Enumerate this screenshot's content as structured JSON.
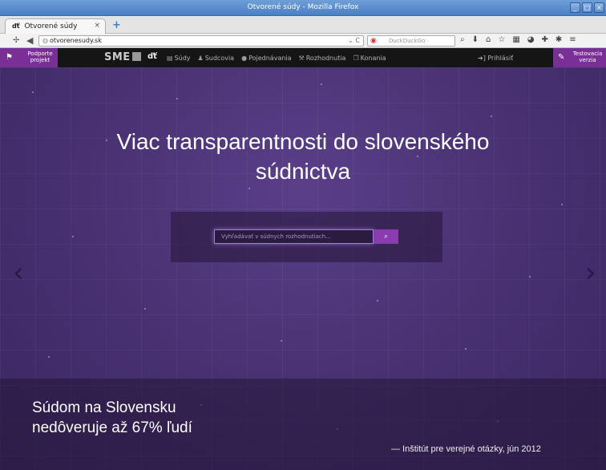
{
  "window": {
    "title": "Otvorené súdy - Mozilla Firefox",
    "buttons": [
      "_",
      "□",
      "×"
    ]
  },
  "tab": {
    "icon": "scales-icon",
    "icon_glyph": "ďť",
    "label": "Otvorené súdy",
    "close": "×"
  },
  "new_tab": "+",
  "address": {
    "url": "otvorenesudy.sk",
    "reload": "⌄ C"
  },
  "search": {
    "placeholder": "DuckDuckGo",
    "engine_glyph": "◉"
  },
  "site_nav": {
    "support_label": "Podporte projekt",
    "logo": "SME",
    "scale_glyph": "ďť",
    "menu": [
      {
        "icon": "document-icon",
        "glyph": "▤",
        "label": "Súdy"
      },
      {
        "icon": "person-icon",
        "glyph": "♟",
        "label": "Sudcovia"
      },
      {
        "icon": "chat-icon",
        "glyph": "●",
        "label": "Pojednávania"
      },
      {
        "icon": "gavel-icon",
        "glyph": "⚒",
        "label": "Rozhodnutia"
      },
      {
        "icon": "copy-icon",
        "glyph": "❐",
        "label": "Konania"
      }
    ],
    "login": "➜] Prihlásiť",
    "beta_label": "Testovacia verzia"
  },
  "hero": {
    "headline": "Viac transparentnosti do slovenského súdnictva",
    "search_placeholder": "Vyhľadávať v súdnych rozhodnutiach...",
    "search_button": "⌕"
  },
  "quote": {
    "text": "Súdom na Slovensku nedôveruje až 67% ľudí",
    "source": "— Inštitút pre verejné otázky, jún 2012"
  },
  "carousel": {
    "prev": "‹",
    "next": "›"
  }
}
